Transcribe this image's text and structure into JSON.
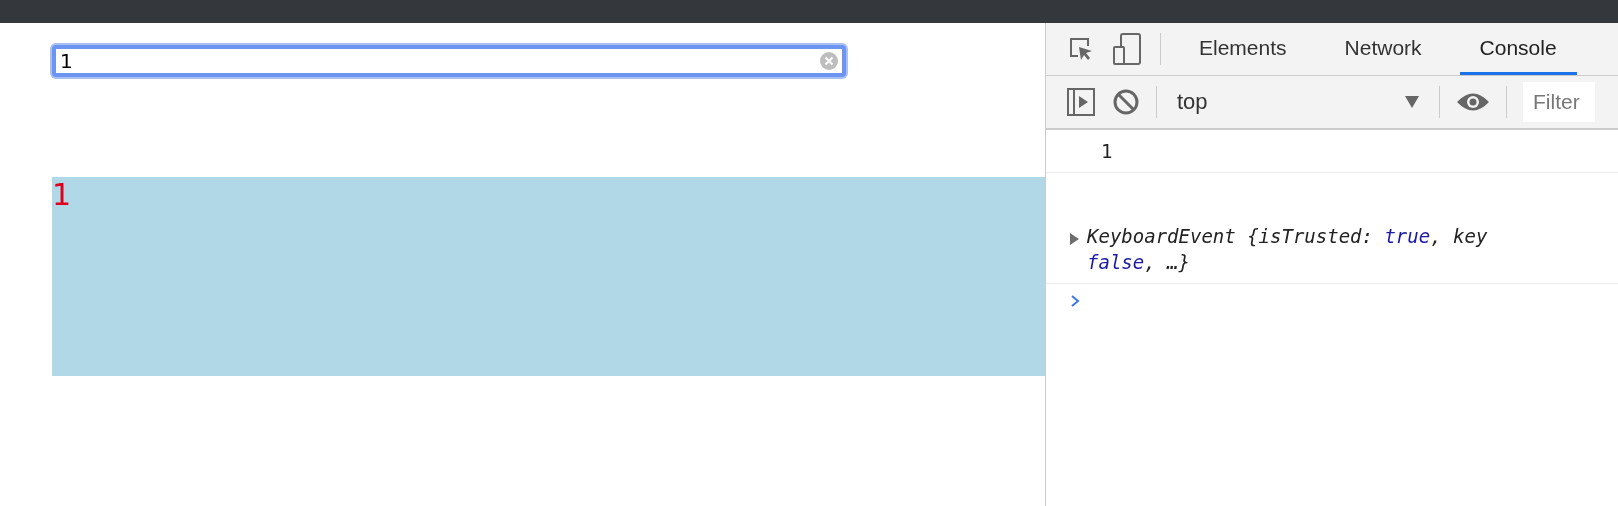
{
  "page": {
    "search": {
      "value": "1"
    },
    "output": {
      "text": "1"
    }
  },
  "devtools": {
    "tabs": [
      {
        "label": "Elements",
        "selected": false
      },
      {
        "label": "Network",
        "selected": false
      },
      {
        "label": "Console",
        "selected": true
      }
    ],
    "context": "top",
    "filter": {
      "placeholder": "Filter"
    },
    "messages": [
      {
        "kind": "text",
        "text": "1"
      },
      {
        "kind": "object",
        "lines": [
          [
            {
              "text": "KeyboardEvent {isTrusted: ",
              "kind": "plain"
            },
            {
              "text": "true",
              "kind": "literal"
            },
            {
              "text": ", key",
              "kind": "plain"
            }
          ],
          [
            {
              "text": "false",
              "kind": "literal"
            },
            {
              "text": ", …}",
              "kind": "plain"
            }
          ]
        ]
      }
    ]
  }
}
